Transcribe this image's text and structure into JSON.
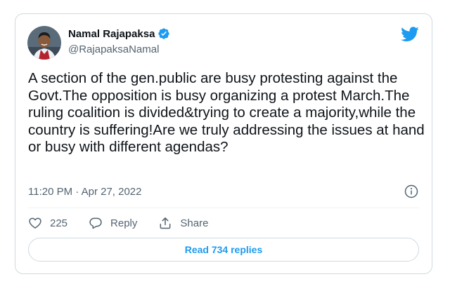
{
  "tweet": {
    "author": {
      "display_name": "Namal Rajapaksa",
      "handle": "@RajapaksaNamal",
      "verified": true,
      "avatar_icon": "profile-photo"
    },
    "text": "A section of the gen.public are busy protesting against the Govt.The opposition is busy organizing a protest March.The ruling coalition is divided&trying to create a majority,while the country is suffering!Are we truly addressing the issues at hand or busy with different agendas?",
    "timestamp": "11:20 PM · Apr 27, 2022",
    "actions": {
      "like_count": "225",
      "reply_label": "Reply",
      "share_label": "Share"
    },
    "read_replies_label": "Read 734 replies"
  },
  "icons": {
    "brand": "twitter-bird-icon",
    "verified": "verified-badge-icon",
    "info": "info-icon",
    "like": "heart-icon",
    "reply": "reply-bubble-icon",
    "share": "share-upload-icon"
  },
  "colors": {
    "accent": "#1d9bf0",
    "text_primary": "#0f1419",
    "text_secondary": "#536471",
    "border": "#cfd9de"
  }
}
